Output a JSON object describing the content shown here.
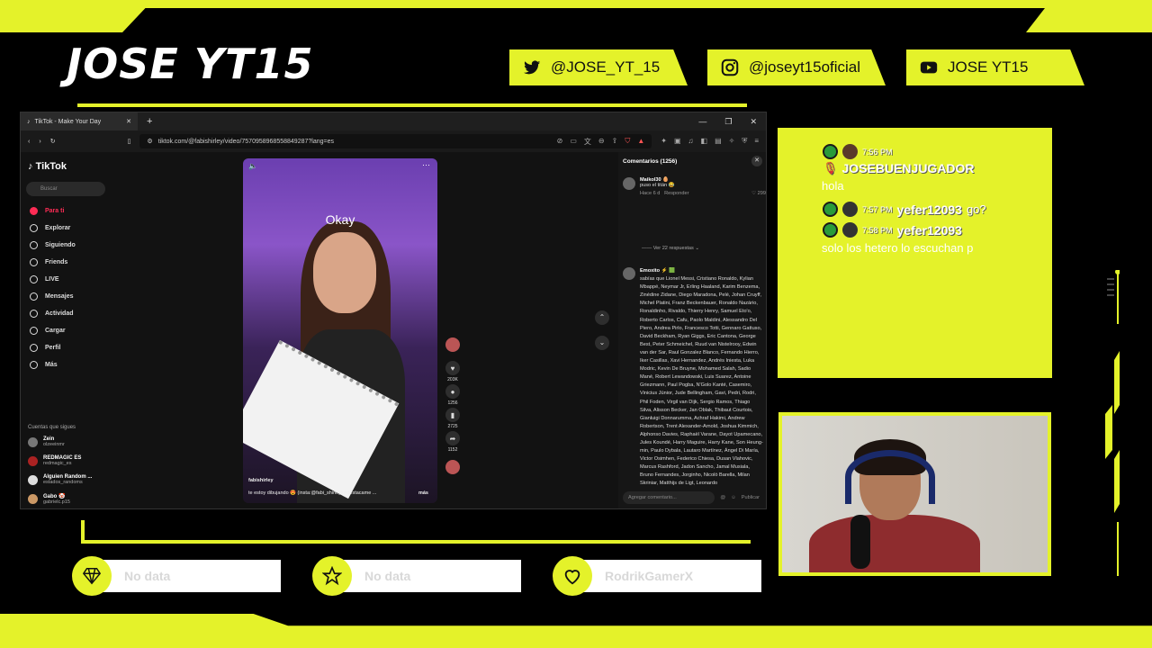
{
  "overlay": {
    "brand": "JOSE YT15",
    "social": [
      {
        "icon": "twitter-icon",
        "label": "@JOSE_YT_15"
      },
      {
        "icon": "instagram-icon",
        "label": "@joseyt15oficial"
      },
      {
        "icon": "youtube-icon",
        "label": "JOSE YT15"
      }
    ],
    "stats": [
      {
        "icon": "diamond-icon",
        "value": "No data"
      },
      {
        "icon": "star-icon",
        "value": "No data"
      },
      {
        "icon": "heart-icon",
        "value": "RodrikGamerX"
      }
    ],
    "accent_color": "#e4f22a"
  },
  "browser": {
    "tab_title": "TikTok - Make Your Day",
    "url": "tiktok.com/@fabishirley/video/7570958968558849287?lang=es"
  },
  "tiktok": {
    "logo": "TikTok",
    "search_placeholder": "Buscar",
    "nav": [
      "Para ti",
      "Explorar",
      "Siguiendo",
      "Friends",
      "LIVE",
      "Mensajes",
      "Actividad",
      "Cargar",
      "Perfil",
      "Más"
    ],
    "following_header": "Cuentas que sigues",
    "following": [
      {
        "name": "Zein",
        "handle": "olzeeinmr"
      },
      {
        "name": "REDMAGIC ES",
        "handle": "redmagic_es"
      },
      {
        "name": "Alguien Random ...",
        "handle": "estados_randoms"
      },
      {
        "name": "Gabo 🤡",
        "handle": "gabrielc.p15"
      },
      {
        "name": "Importaciones Br...",
        "handle": "breshstorepere"
      }
    ],
    "see_more": "Ver más",
    "video": {
      "overlay_text": "Okay",
      "author": "fabishirley",
      "caption": "te estoy dibujando 😍 (insta:@fabi_shirley) #destacame ...",
      "more": "más"
    },
    "actions": {
      "likes": "203K",
      "comments": "1256",
      "saves": "2725",
      "shares": "1152"
    },
    "comments_panel": {
      "title": "Comentarios (1256)",
      "first": {
        "user": "Maikol30 🥚",
        "text": "puso el titán 😂",
        "time": "Hace 6 d",
        "reply": "Responder",
        "likes": "299",
        "view_replies": "Ver 22 respuestas"
      },
      "second": {
        "user": "Emoxito ⚡ 🟩",
        "text": "sabías que Lionel Messi, Cristiano Ronaldo, Kylian Mbappé, Neymar Jr, Erling Haaland, Karim Benzema, Zinédine Zidane, Diego Maradona, Pelé, Johan Cruyff, Michel Platini, Franz Beckenbauer, Ronaldo Nazário, Ronaldinho, Rivaldo, Thierry Henry, Samuel Eto'o, Roberto Carlos, Cafu, Paolo Maldini, Alessandro Del Piero, Andrea Pirlo, Francesco Totti, Gennaro Gattuso, David Beckham, Ryan Giggs, Eric Cantona, George Best, Peter Schmeichel, Ruud van Nistelrooy, Edwin van der Sar, Raul Gonzalez Blanco, Fernando Hierro, Iker Casillas, Xavi Hernandez, Andrés Iniesta, Luka Modric, Kevin De Bruyne, Mohamed Salah, Sadio Mané, Robert Lewandowski, Luis Suarez, Antoine Griezmann, Paul Pogba, N'Golo Kanté, Casemiro, Vinicius Júnior, Jude Bellingham, Gavi, Pedri, Rodri, Phil Foden, Virgil van Dijk, Sergio Ramos, Thiago Silva, Alisson Becker, Jan Oblak, Thibaut Courtois, Gianluigi Donnarumma, Achraf Hakimi, Andrew Robertson, Trent Alexander-Arnold, Joshua Kimmich, Alphonso Davies, Raphaël Varane, Dayot Upamecano, Jules Koundé, Harry Maguire, Harry Kane, Son Heung-min, Paulo Dybala, Lautaro Martínez, Ángel Di María, Victor Osimhen, Federico Chiesa, Dusan Vlahovic, Marcus Rashford, Jadon Sancho, Jamal Musiala, Bruno Fernandes, Jorginho, Nicolò Barella, Milan Skriniar, Matthijs de Ligt, Leonardo"
      },
      "input_placeholder": "Agregar comentario...",
      "publish": "Publicar"
    }
  },
  "chat": [
    {
      "time": "7:56 PM",
      "user": "JOSEBUENJUGADOR",
      "message": "hola"
    },
    {
      "time": "7:57 PM",
      "user": "yefer12093",
      "message": "go?"
    },
    {
      "time": "7:58 PM",
      "user": "yefer12093",
      "message": "solo los hetero lo escuchan p"
    }
  ]
}
